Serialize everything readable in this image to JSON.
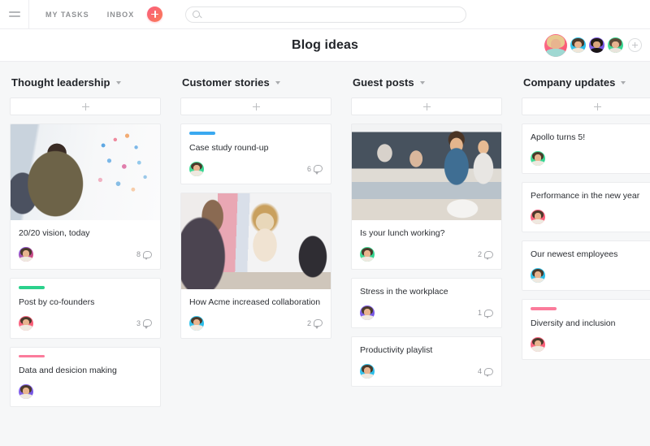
{
  "topbar": {
    "menu_icon": "hamburger-icon",
    "nav": [
      {
        "label": "MY TASKS"
      },
      {
        "label": "INBOX"
      }
    ],
    "create_button_label": "+",
    "search": {
      "placeholder": "",
      "value": "",
      "icon": "search-icon"
    }
  },
  "project": {
    "title": "Blog ideas",
    "members": [
      {
        "name": "member-1",
        "color": "#fb6f8c",
        "size": "large"
      },
      {
        "name": "member-2",
        "color": "#22b8e6",
        "size": "small"
      },
      {
        "name": "member-3",
        "color": "#6f4fe0",
        "size": "small"
      },
      {
        "name": "member-4",
        "color": "#2bd18c",
        "size": "small"
      }
    ],
    "add_member_label": "+"
  },
  "board": {
    "add_card_label": "+",
    "columns": [
      {
        "title": "Thought leadership",
        "cards": [
          {
            "title": "20/20 vision, today",
            "image": "photo-stickies",
            "tag_color": "",
            "avatar_color": "av-purplered",
            "comments": "8"
          },
          {
            "title": "Post by co-founders",
            "image": "",
            "tag_color": "#2bd18c",
            "avatar_color": "av-pink",
            "comments": "3"
          },
          {
            "title": "Data and desicion making",
            "image": "",
            "tag_color": "#fb7b9b",
            "avatar_color": "av-purple",
            "comments": ""
          }
        ]
      },
      {
        "title": "Customer stories",
        "cards": [
          {
            "title": "Case study round-up",
            "image": "",
            "tag_color": "#3aa9f0",
            "avatar_color": "av-green",
            "comments": "6"
          },
          {
            "title": "How Acme increased collaboration",
            "image": "photo-meeting",
            "tag_color": "",
            "avatar_color": "av-cyan",
            "comments": "2"
          }
        ]
      },
      {
        "title": "Guest posts",
        "cards": [
          {
            "title": "Is your lunch working?",
            "image": "photo-lunch",
            "tag_color": "",
            "avatar_color": "av-green",
            "comments": "2"
          },
          {
            "title": "Stress in the workplace",
            "image": "",
            "tag_color": "",
            "avatar_color": "av-purple",
            "comments": "1"
          },
          {
            "title": "Productivity playlist",
            "image": "",
            "tag_color": "",
            "avatar_color": "av-cyan",
            "comments": "4"
          }
        ]
      },
      {
        "title": "Company updates",
        "cards": [
          {
            "title": "Apollo turns 5!",
            "image": "",
            "tag_color": "",
            "avatar_color": "av-green",
            "comments": ""
          },
          {
            "title": "Performance in the new year",
            "image": "",
            "tag_color": "",
            "avatar_color": "av-pink",
            "comments": ""
          },
          {
            "title": "Our newest employees",
            "image": "",
            "tag_color": "",
            "avatar_color": "av-cyan",
            "comments": ""
          },
          {
            "title": "Diversity and inclusion",
            "image": "",
            "tag_color": "#fb7b9b",
            "avatar_color": "av-pink",
            "comments": ""
          }
        ]
      }
    ]
  },
  "colors": {
    "accent_pink": "#f95e7e",
    "board_bg": "#f6f7f8",
    "card_bg": "#ffffff"
  }
}
